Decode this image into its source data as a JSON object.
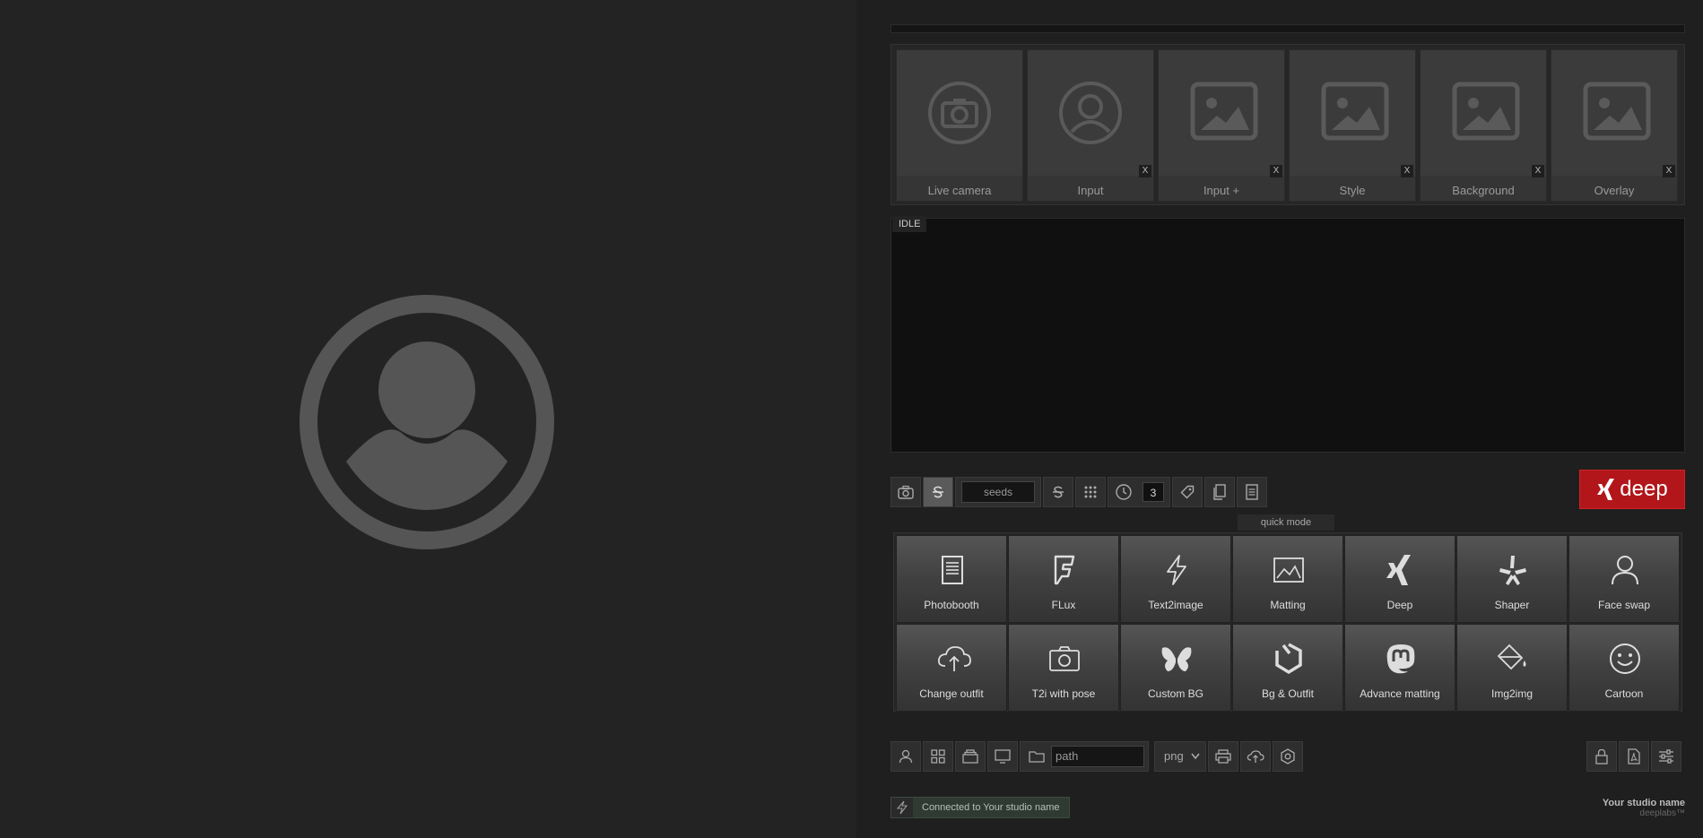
{
  "sources": [
    {
      "label": "Live camera",
      "icon": "camera-icon",
      "closable": false
    },
    {
      "label": "Input",
      "icon": "user-circle-icon",
      "closable": true
    },
    {
      "label": "Input +",
      "icon": "image-icon",
      "closable": true
    },
    {
      "label": "Style",
      "icon": "image-icon",
      "closable": true
    },
    {
      "label": "Background",
      "icon": "image-icon",
      "closable": true
    },
    {
      "label": "Overlay",
      "icon": "image-icon",
      "closable": true
    }
  ],
  "close_label": "X",
  "status": "IDLE",
  "toolbar": {
    "seeds_placeholder": "seeds",
    "count": "3",
    "deep_label": "deep"
  },
  "quick_mode_label": "quick mode",
  "modes": [
    {
      "label": "Photobooth",
      "icon": "document-icon"
    },
    {
      "label": "FLux",
      "icon": "foursquare-icon"
    },
    {
      "label": "Text2image",
      "icon": "lightning-icon"
    },
    {
      "label": "Matting",
      "icon": "image-frame-icon"
    },
    {
      "label": "Deep",
      "icon": "xing-icon"
    },
    {
      "label": "Shaper",
      "icon": "yelp-icon"
    },
    {
      "label": "Face swap",
      "icon": "person-icon"
    },
    {
      "label": "Change outfit",
      "icon": "cloud-upload-icon"
    },
    {
      "label": "T2i with pose",
      "icon": "camera-icon"
    },
    {
      "label": "Custom BG",
      "icon": "butterfly-icon"
    },
    {
      "label": "Bg & Outfit",
      "icon": "hexagon-logo-icon"
    },
    {
      "label": "Advance matting",
      "icon": "mastodon-icon"
    },
    {
      "label": "Img2img",
      "icon": "paint-bucket-icon"
    },
    {
      "label": "Cartoon",
      "icon": "smiley-icon"
    }
  ],
  "bottom": {
    "path_placeholder": "path",
    "format_value": "png"
  },
  "connection": "Connected to Your studio name",
  "studio_name": "Your studio name",
  "brand": "deeplabs™",
  "colors": {
    "accent": "#b2161a",
    "connected": "#2f3a33"
  }
}
